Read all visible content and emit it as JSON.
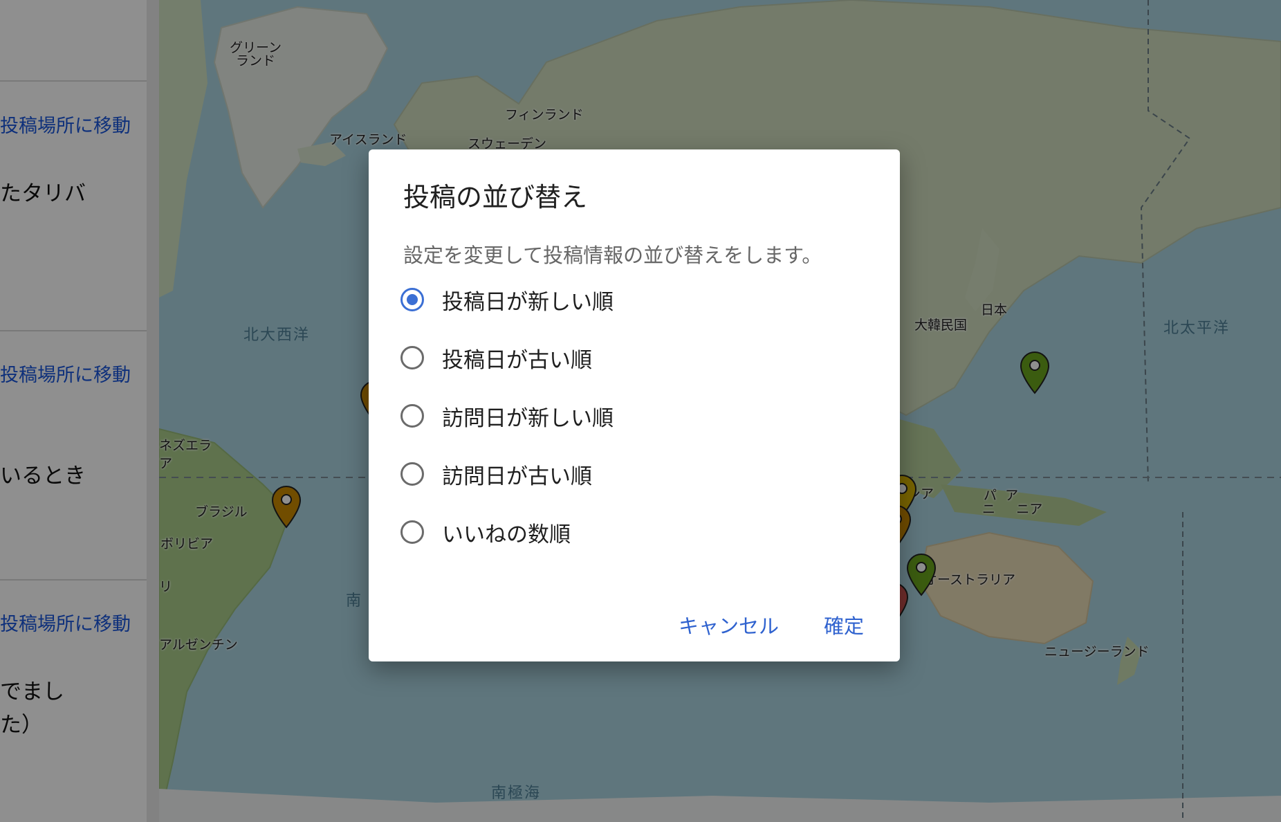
{
  "sidebar": {
    "posts": [
      {
        "move_label": "投稿場所に移動",
        "excerpt_lines": [
          "たタリバ"
        ]
      },
      {
        "move_label": "投稿場所に移動",
        "excerpt_lines": [
          "いるとき"
        ]
      },
      {
        "move_label": "投稿場所に移動",
        "excerpt_lines": [
          "でまし",
          "た）"
        ]
      }
    ]
  },
  "map": {
    "labels": {
      "greenland": "グリーン\nランド",
      "finland": "フィンランド",
      "iceland": "アイスランド",
      "sweden": "スウェーデン",
      "north_atlantic": "北大西洋",
      "north_pacific": "北太平洋",
      "south_ocean_partial": "南",
      "southern_ocean": "南極海",
      "venezuela": "ネズエラ",
      "venezuela_a": "ア",
      "brazil": "ブラジル",
      "bolivia": "ボリビア",
      "chile": "リ",
      "argentina": "アルゼンチン",
      "south_korea": "大韓民国",
      "japan": "日本",
      "indonesia": "シア",
      "png_top": "パ  ア",
      "png_bottom": "ニ     ニア",
      "australia": "オーストラリア",
      "new_zealand": "ニュージーランド"
    },
    "pin_colors": {
      "green": "#6aa51e",
      "dark_green": "#3f6e0f",
      "gray": "#5e5e5e",
      "orange": "#c98a00",
      "yellow": "#d6b300",
      "red": "#c9504f"
    }
  },
  "dialog": {
    "title": "投稿の並び替え",
    "description": "設定を変更して投稿情報の並び替えをします。",
    "selected_index": 0,
    "options": [
      "投稿日が新しい順",
      "投稿日が古い順",
      "訪問日が新しい順",
      "訪問日が古い順",
      "いいねの数順"
    ],
    "cancel_label": "キャンセル",
    "confirm_label": "確定"
  },
  "colors": {
    "accent": "#3b6fd4",
    "link": "#1a56db",
    "scrim": "rgba(0,0,0,0.44)"
  }
}
